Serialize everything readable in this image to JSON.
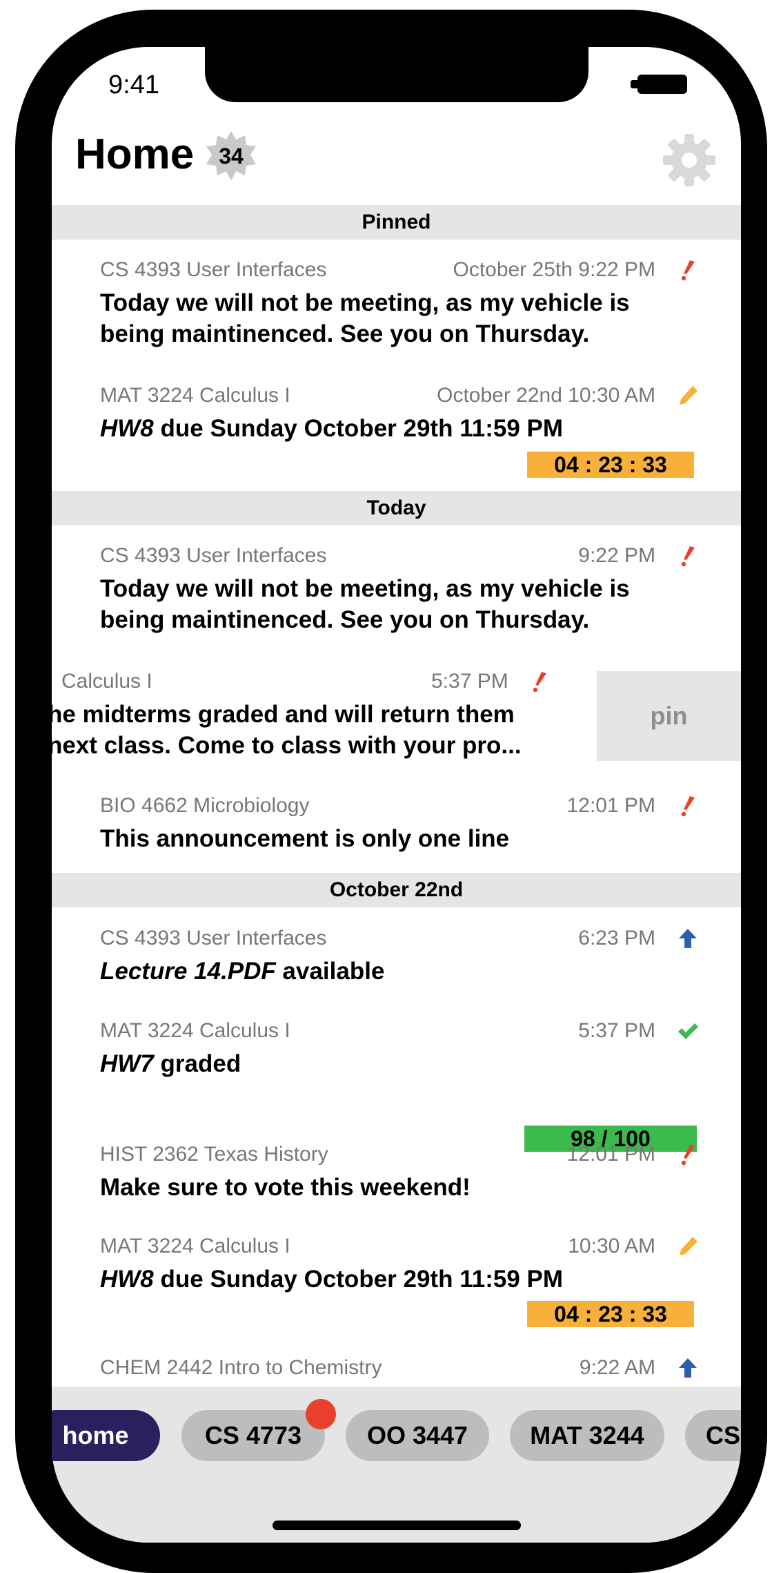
{
  "status": {
    "time": "9:41"
  },
  "header": {
    "title": "Home",
    "badge_count": "34"
  },
  "sections": {
    "pinned": "Pinned",
    "today": "Today",
    "oct22": "October 22nd"
  },
  "pinned": [
    {
      "course": "CS 4393 User Interfaces",
      "date": "October 25th 9:22 PM",
      "icon": "exclamation-icon",
      "message": "Today we will not be meeting, as my vehicle is being maintinenced. See you on Thursday."
    },
    {
      "course": "MAT 3224 Calculus I",
      "date": "October 22nd 10:30 AM",
      "icon": "pencil-icon",
      "message_em": "HW8",
      "message_rest": " due Sunday October 29th 11:59 PM",
      "countdown": "04 : 23 : 33"
    }
  ],
  "today": [
    {
      "course": "CS 4393 User Interfaces",
      "date": "9:22 PM",
      "icon": "exclamation-icon",
      "message": "Today we will not be meeting, as my vehicle is being maintinenced. See you on Thursday."
    },
    {
      "course": "Calculus I",
      "date": "5:37 PM",
      "icon": "exclamation-icon",
      "line1": "he midterms graded and will return them",
      "line2": "next class. Come to class with your pro...",
      "action": "pin"
    },
    {
      "course": "BIO 4662 Microbiology",
      "date": "12:01 PM",
      "icon": "exclamation-icon",
      "message": "This announcement is only one line"
    }
  ],
  "oct22": [
    {
      "course": "CS 4393 User Interfaces",
      "date": "6:23 PM",
      "icon": "upload-arrow-icon",
      "message_em": "Lecture 14.PDF",
      "message_rest": " available"
    },
    {
      "course": "MAT 3224 Calculus I",
      "date": "5:37 PM",
      "icon": "checkmark-icon",
      "message_em": "HW7",
      "message_rest": " graded",
      "grade": "98 / 100"
    },
    {
      "course": "HIST 2362 Texas History",
      "date": "12:01 PM",
      "icon": "exclamation-icon",
      "message": "Make sure to vote this weekend!"
    },
    {
      "course": "MAT 3224 Calculus I",
      "date": "10:30 AM",
      "icon": "pencil-icon",
      "message_em": "HW8",
      "message_rest": " due Sunday October 29th 11:59 PM",
      "countdown": "04 : 23 : 33"
    },
    {
      "course": "CHEM 2442 Intro to Chemistry",
      "date": "9:22 AM",
      "icon": "upload-arrow-icon"
    }
  ],
  "tabs": [
    "home",
    "CS 4773",
    "OO 3447",
    "MAT 3244",
    "CS"
  ],
  "colors": {
    "accent_red": "#e8412c",
    "accent_orange": "#f7b13b",
    "accent_green": "#3dba4e",
    "accent_blue": "#2d5fb0",
    "active_tab": "#2b1f5e"
  }
}
